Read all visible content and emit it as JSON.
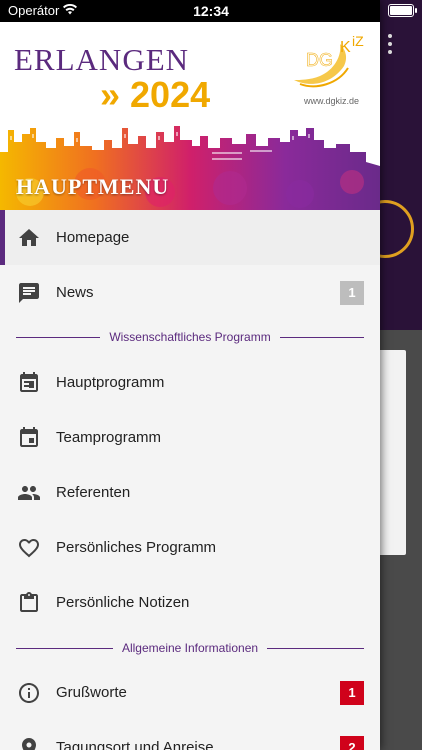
{
  "status_bar": {
    "carrier": "Operátor",
    "time": "12:34"
  },
  "header": {
    "brand_line1": "ERLANGEN",
    "brand_line2": "» 2024",
    "logo_text": "DGKiZ",
    "logo_url": "www.dgkiz.de",
    "menu_title": "HAUPTMENU"
  },
  "menu": {
    "items": [
      {
        "label": "Homepage",
        "icon": "home-icon",
        "active": true
      },
      {
        "label": "News",
        "icon": "news-icon",
        "badge": "1",
        "badge_color": "#bdbdbd"
      }
    ],
    "section1": "Wissenschaftliches Programm",
    "items2": [
      {
        "label": "Hauptprogramm",
        "icon": "calendar-icon"
      },
      {
        "label": "Teamprogramm",
        "icon": "calendar-event-icon"
      },
      {
        "label": "Referenten",
        "icon": "people-icon"
      },
      {
        "label": "Persönliches Programm",
        "icon": "heart-icon"
      },
      {
        "label": "Persönliche Notizen",
        "icon": "clipboard-icon"
      }
    ],
    "section2": "Allgemeine Informationen",
    "items3": [
      {
        "label": "Grußworte",
        "icon": "info-icon",
        "badge": "1",
        "badge_color": "#d0021b"
      },
      {
        "label": "Tagungsort und Anreise",
        "icon": "location-icon",
        "badge": "2",
        "badge_color": "#d0021b"
      }
    ]
  },
  "colors": {
    "accent": "#5b2a7e",
    "brand_yellow": "#f0a800",
    "badge_red": "#d0021b"
  }
}
